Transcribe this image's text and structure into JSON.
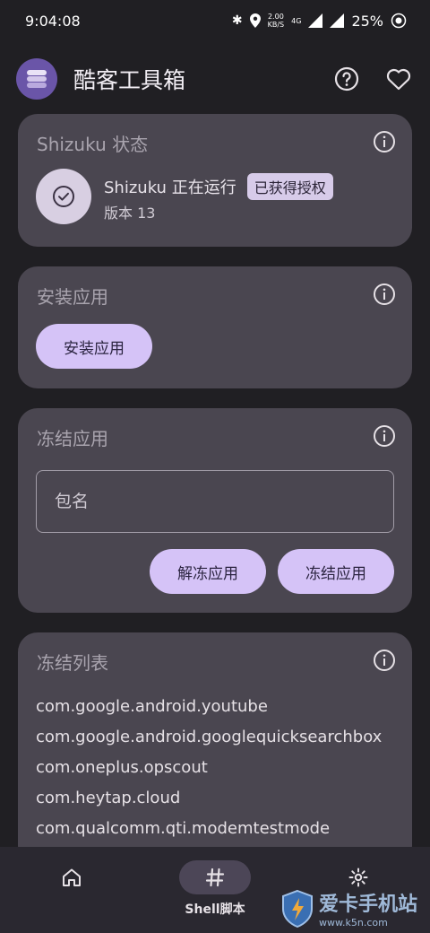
{
  "status_bar": {
    "time": "9:04:08",
    "net_speed_value": "2.00",
    "net_speed_unit": "KB/S",
    "network_type": "4G",
    "battery": "25%"
  },
  "app_bar": {
    "title": "酷客工具箱",
    "icons": [
      "app-logo",
      "help-icon",
      "favorite-icon"
    ]
  },
  "shizuku_card": {
    "title": "Shizuku 状态",
    "status": "Shizuku 正在运行",
    "badge": "已获得授权",
    "version": "版本 13"
  },
  "install_card": {
    "title": "安装应用",
    "button": "安装应用"
  },
  "freeze_card": {
    "title": "冻结应用",
    "input_placeholder": "包名",
    "input_value": "",
    "unfreeze_button": "解冻应用",
    "freeze_button": "冻结应用"
  },
  "freeze_list_card": {
    "title": "冻结列表",
    "items": [
      "com.google.android.youtube",
      "com.google.android.googlequicksearchbox",
      "com.oneplus.opscout",
      "com.heytap.cloud",
      "com.qualcomm.qti.modemtestmode"
    ]
  },
  "bottom_nav": {
    "items": [
      {
        "icon": "home-icon",
        "label": ""
      },
      {
        "icon": "hash-icon",
        "label": "Shell脚本",
        "active": true
      },
      {
        "icon": "settings-icon",
        "label": ""
      }
    ]
  },
  "watermark": {
    "main": "爱卡手机站",
    "sub": "www.k5n.com"
  },
  "colors": {
    "background": "#201f23",
    "card": "#4a4650",
    "accent_button": "#d5c3f7",
    "badge": "#d7cbe9"
  }
}
